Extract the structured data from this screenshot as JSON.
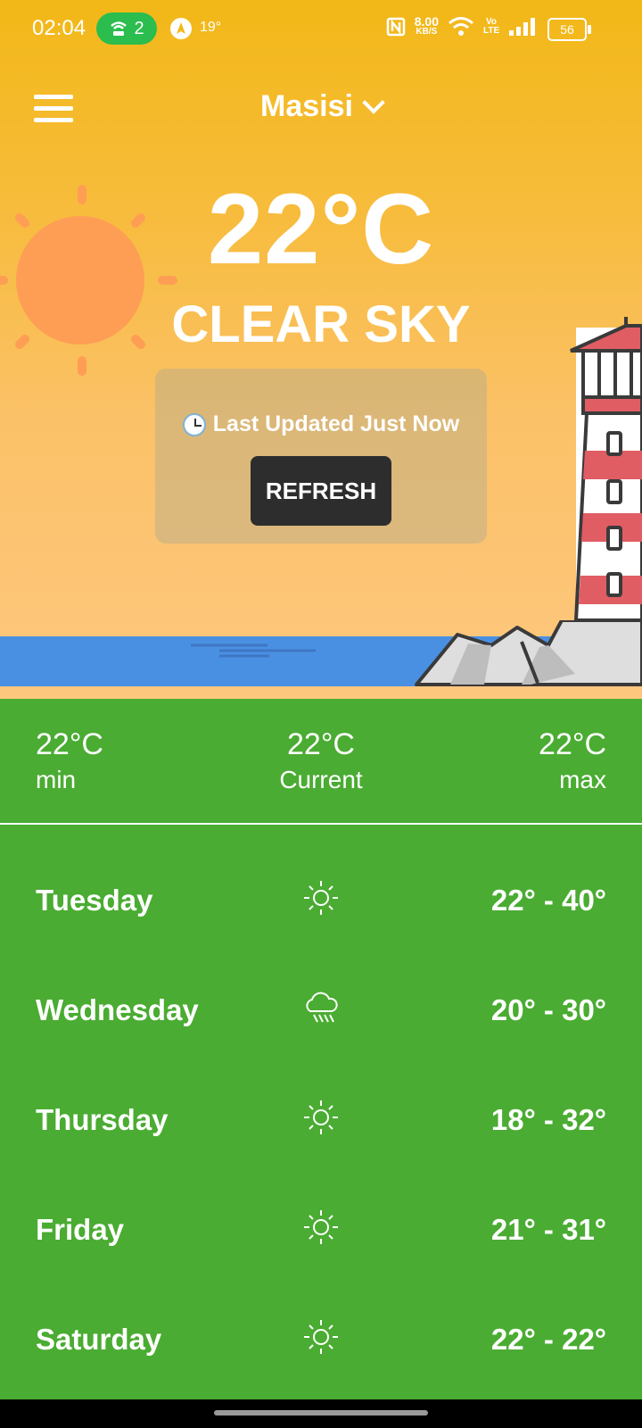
{
  "status_bar": {
    "time": "02:04",
    "hotspot_count": "2",
    "temperature": "19°",
    "net_speed_value": "8.00",
    "net_speed_unit": "KB/S",
    "volte": "Vo LTE",
    "battery": "56"
  },
  "header": {
    "city": "Masisi"
  },
  "current": {
    "temperature": "22°C",
    "condition": "CLEAR SKY",
    "last_updated": "Last Updated Just Now",
    "refresh_label": "REFRESH"
  },
  "summary": {
    "min_value": "22°C",
    "min_label": "min",
    "current_value": "22°C",
    "current_label": "Current",
    "max_value": "22°C",
    "max_label": "max"
  },
  "forecast": [
    {
      "day": "Tuesday",
      "icon": "sun-icon",
      "range": "22° - 40°"
    },
    {
      "day": "Wednesday",
      "icon": "rain-cloud-icon",
      "range": "20° - 30°"
    },
    {
      "day": "Thursday",
      "icon": "sun-icon",
      "range": "18° - 32°"
    },
    {
      "day": "Friday",
      "icon": "sun-icon",
      "range": "21° - 31°"
    },
    {
      "day": "Saturday",
      "icon": "sun-icon",
      "range": "22° - 22°"
    }
  ],
  "colors": {
    "sky_top": "#f2b817",
    "sky_bottom": "#fec77e",
    "sun": "#fe9e55",
    "sea": "#4a90e2",
    "green": "#4aac32",
    "refresh_button": "#2d2d2d"
  }
}
